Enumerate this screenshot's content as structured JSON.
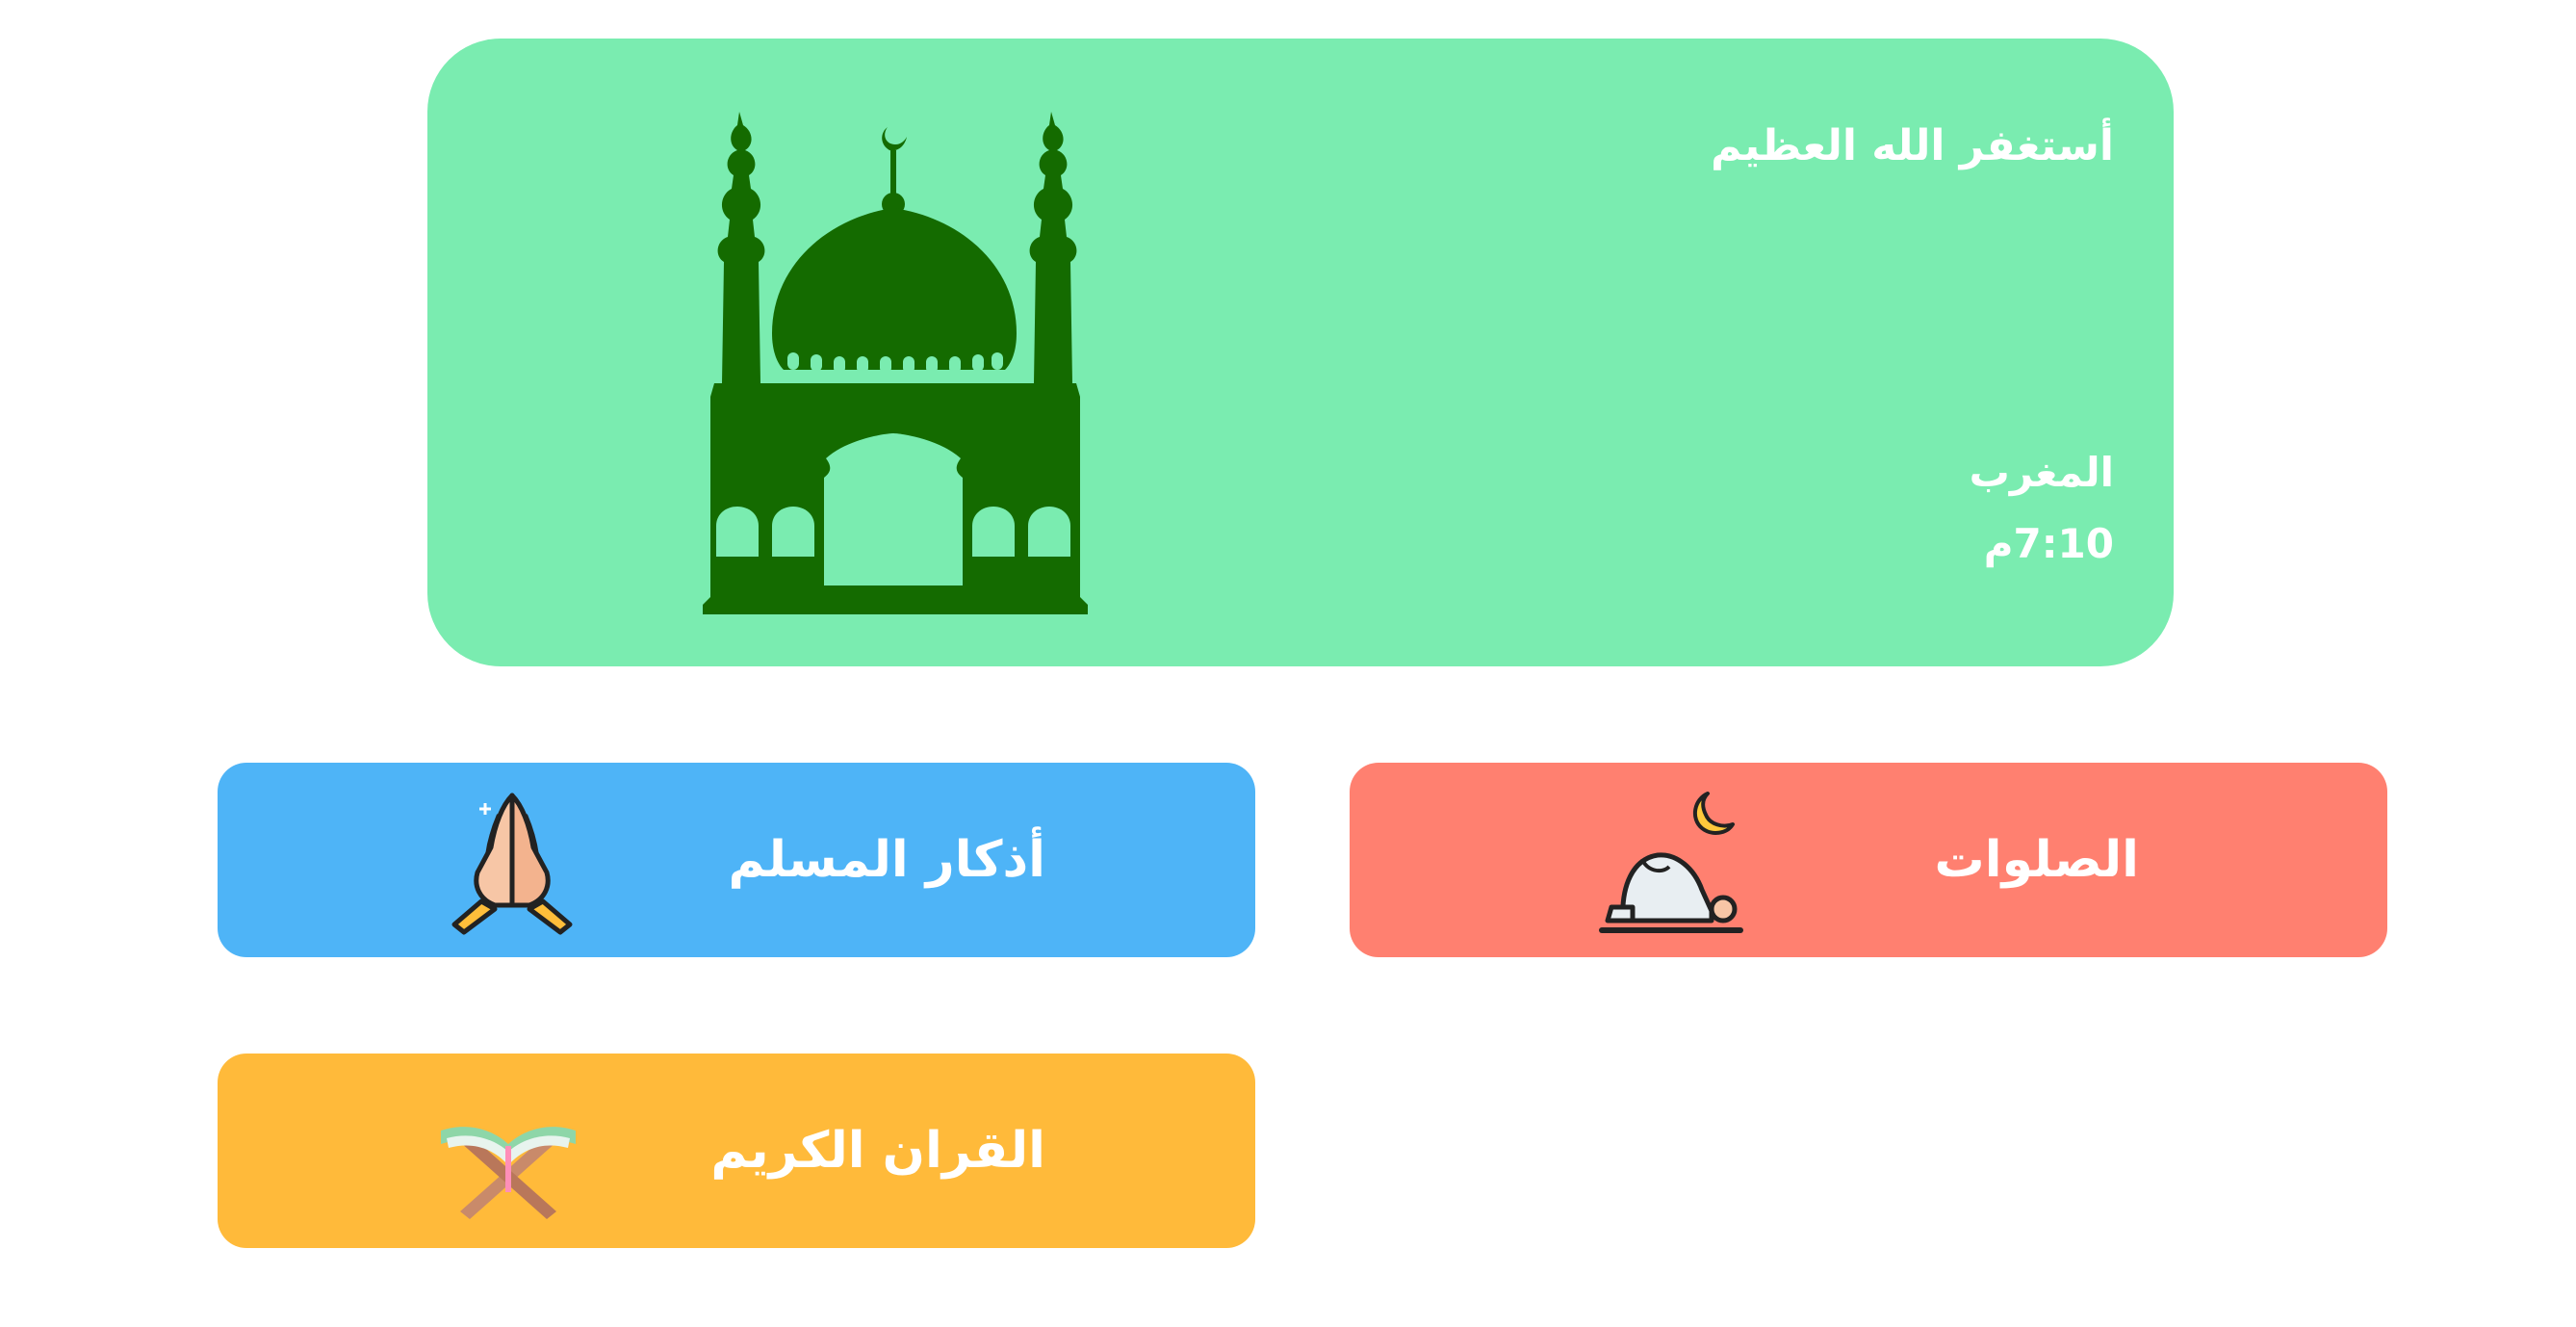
{
  "hero": {
    "dhikr": "أستغفر الله العظيم",
    "prayer_name": "المغرب",
    "prayer_time": "7:10م",
    "icon": "mosque-icon",
    "background_color": "#7aecb0",
    "icon_color": "#146b00"
  },
  "cards": {
    "azkar": {
      "label": "أذكار المسلم",
      "icon": "praying-hands-icon",
      "color": "#4eb4f7"
    },
    "salawat": {
      "label": "الصلوات",
      "icon": "prostrating-person-icon",
      "color": "#ff8070"
    },
    "quran": {
      "label": "القران الكريم",
      "icon": "quran-book-icon",
      "color": "#ffba3a"
    }
  }
}
